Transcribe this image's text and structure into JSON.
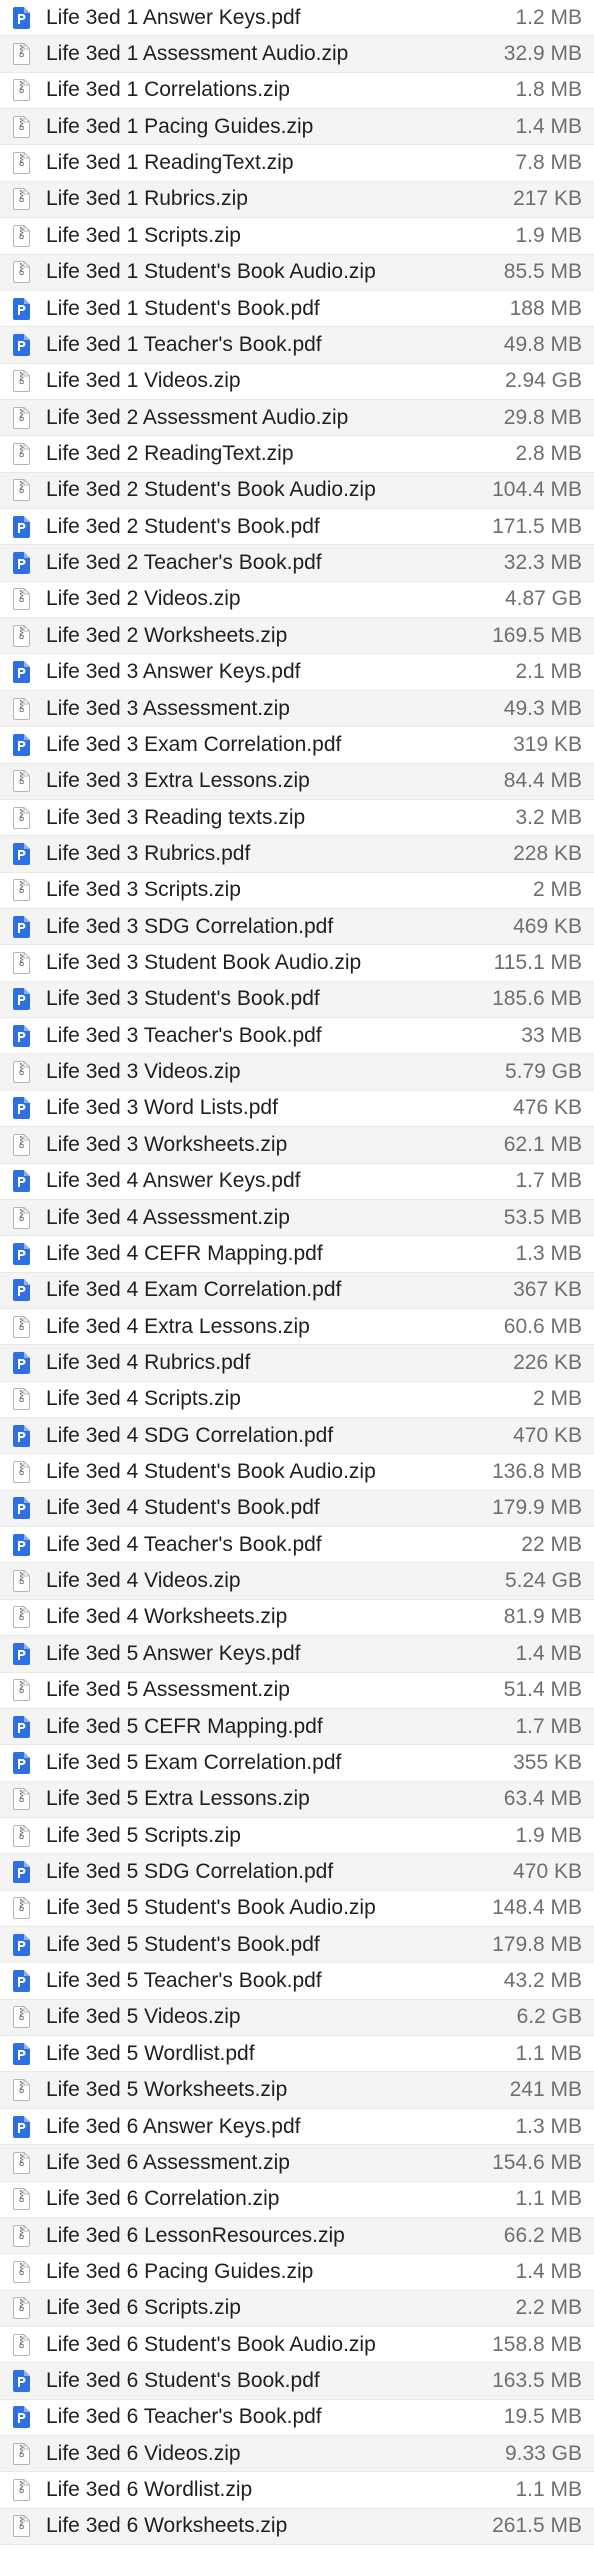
{
  "colors": {
    "pdf_icon": "#2f6fe4",
    "zip_icon_border": "#b5b5b5",
    "size_text": "#6e6e73",
    "stripe": "#f4f4f5"
  },
  "files": [
    {
      "name": "Life 3ed 1 Answer Keys.pdf",
      "size": "1.2 MB",
      "icon": "pdf-icon"
    },
    {
      "name": "Life 3ed 1 Assessment Audio.zip",
      "size": "32.9 MB",
      "icon": "zip-icon"
    },
    {
      "name": "Life 3ed 1 Correlations.zip",
      "size": "1.8 MB",
      "icon": "zip-icon"
    },
    {
      "name": "Life 3ed 1 Pacing Guides.zip",
      "size": "1.4 MB",
      "icon": "zip-icon"
    },
    {
      "name": "Life 3ed 1 ReadingText.zip",
      "size": "7.8 MB",
      "icon": "zip-icon"
    },
    {
      "name": "Life 3ed 1 Rubrics.zip",
      "size": "217 KB",
      "icon": "zip-icon"
    },
    {
      "name": "Life 3ed 1 Scripts.zip",
      "size": "1.9 MB",
      "icon": "zip-icon"
    },
    {
      "name": "Life 3ed 1 Student's Book Audio.zip",
      "size": "85.5 MB",
      "icon": "zip-icon"
    },
    {
      "name": "Life 3ed 1 Student's Book.pdf",
      "size": "188 MB",
      "icon": "pdf-icon"
    },
    {
      "name": "Life 3ed 1 Teacher's Book.pdf",
      "size": "49.8 MB",
      "icon": "pdf-icon"
    },
    {
      "name": "Life 3ed 1 Videos.zip",
      "size": "2.94 GB",
      "icon": "zip-icon"
    },
    {
      "name": "Life 3ed 2 Assessment Audio.zip",
      "size": "29.8 MB",
      "icon": "zip-icon"
    },
    {
      "name": "Life 3ed 2 ReadingText.zip",
      "size": "2.8 MB",
      "icon": "zip-icon"
    },
    {
      "name": "Life 3ed 2 Student's Book Audio.zip",
      "size": "104.4 MB",
      "icon": "zip-icon"
    },
    {
      "name": "Life 3ed 2 Student's Book.pdf",
      "size": "171.5 MB",
      "icon": "pdf-icon"
    },
    {
      "name": "Life 3ed 2 Teacher's Book.pdf",
      "size": "32.3 MB",
      "icon": "pdf-icon"
    },
    {
      "name": "Life 3ed 2 Videos.zip",
      "size": "4.87 GB",
      "icon": "zip-icon"
    },
    {
      "name": "Life 3ed 2 Worksheets.zip",
      "size": "169.5 MB",
      "icon": "zip-icon"
    },
    {
      "name": "Life 3ed 3 Answer Keys.pdf",
      "size": "2.1 MB",
      "icon": "pdf-icon"
    },
    {
      "name": "Life 3ed 3 Assessment.zip",
      "size": "49.3 MB",
      "icon": "zip-icon"
    },
    {
      "name": "Life 3ed 3 Exam Correlation.pdf",
      "size": "319 KB",
      "icon": "pdf-icon"
    },
    {
      "name": "Life 3ed 3 Extra Lessons.zip",
      "size": "84.4 MB",
      "icon": "zip-icon"
    },
    {
      "name": "Life 3ed 3 Reading texts.zip",
      "size": "3.2 MB",
      "icon": "zip-icon"
    },
    {
      "name": "Life 3ed 3 Rubrics.pdf",
      "size": "228 KB",
      "icon": "pdf-icon"
    },
    {
      "name": "Life 3ed 3 Scripts.zip",
      "size": "2 MB",
      "icon": "zip-icon"
    },
    {
      "name": "Life 3ed 3 SDG Correlation.pdf",
      "size": "469 KB",
      "icon": "pdf-icon"
    },
    {
      "name": "Life 3ed 3 Student Book Audio.zip",
      "size": "115.1 MB",
      "icon": "zip-icon"
    },
    {
      "name": "Life 3ed 3 Student's Book.pdf",
      "size": "185.6 MB",
      "icon": "pdf-icon"
    },
    {
      "name": "Life 3ed 3 Teacher's Book.pdf",
      "size": "33 MB",
      "icon": "pdf-icon"
    },
    {
      "name": "Life 3ed 3 Videos.zip",
      "size": "5.79 GB",
      "icon": "zip-icon"
    },
    {
      "name": "Life 3ed 3 Word Lists.pdf",
      "size": "476 KB",
      "icon": "pdf-icon"
    },
    {
      "name": "Life 3ed 3 Worksheets.zip",
      "size": "62.1 MB",
      "icon": "zip-icon"
    },
    {
      "name": "Life 3ed 4 Answer Keys.pdf",
      "size": "1.7 MB",
      "icon": "pdf-icon"
    },
    {
      "name": "Life 3ed 4 Assessment.zip",
      "size": "53.5 MB",
      "icon": "zip-icon"
    },
    {
      "name": "Life 3ed 4 CEFR Mapping.pdf",
      "size": "1.3 MB",
      "icon": "pdf-icon"
    },
    {
      "name": "Life 3ed 4 Exam Correlation.pdf",
      "size": "367 KB",
      "icon": "pdf-icon"
    },
    {
      "name": "Life 3ed 4 Extra Lessons.zip",
      "size": "60.6 MB",
      "icon": "zip-icon"
    },
    {
      "name": "Life 3ed 4 Rubrics.pdf",
      "size": "226 KB",
      "icon": "pdf-icon"
    },
    {
      "name": "Life 3ed 4 Scripts.zip",
      "size": "2 MB",
      "icon": "zip-icon"
    },
    {
      "name": "Life 3ed 4 SDG Correlation.pdf",
      "size": "470 KB",
      "icon": "pdf-icon"
    },
    {
      "name": "Life 3ed 4 Student's Book Audio.zip",
      "size": "136.8 MB",
      "icon": "zip-icon"
    },
    {
      "name": "Life 3ed 4 Student's Book.pdf",
      "size": "179.9 MB",
      "icon": "pdf-icon"
    },
    {
      "name": "Life 3ed 4 Teacher's Book.pdf",
      "size": "22 MB",
      "icon": "pdf-icon"
    },
    {
      "name": "Life 3ed 4 Videos.zip",
      "size": "5.24 GB",
      "icon": "zip-icon"
    },
    {
      "name": "Life 3ed 4 Worksheets.zip",
      "size": "81.9 MB",
      "icon": "zip-icon"
    },
    {
      "name": "Life 3ed 5 Answer Keys.pdf",
      "size": "1.4 MB",
      "icon": "pdf-icon"
    },
    {
      "name": "Life 3ed 5 Assessment.zip",
      "size": "51.4 MB",
      "icon": "zip-icon"
    },
    {
      "name": "Life 3ed 5 CEFR Mapping.pdf",
      "size": "1.7 MB",
      "icon": "pdf-icon"
    },
    {
      "name": "Life 3ed 5 Exam Correlation.pdf",
      "size": "355 KB",
      "icon": "pdf-icon"
    },
    {
      "name": "Life 3ed 5 Extra Lessons.zip",
      "size": "63.4 MB",
      "icon": "zip-icon"
    },
    {
      "name": "Life 3ed 5 Scripts.zip",
      "size": "1.9 MB",
      "icon": "zip-icon"
    },
    {
      "name": "Life 3ed 5 SDG Correlation.pdf",
      "size": "470 KB",
      "icon": "pdf-icon"
    },
    {
      "name": "Life 3ed 5 Student's Book Audio.zip",
      "size": "148.4 MB",
      "icon": "zip-icon"
    },
    {
      "name": "Life 3ed 5 Student's Book.pdf",
      "size": "179.8 MB",
      "icon": "pdf-icon"
    },
    {
      "name": "Life 3ed 5 Teacher's Book.pdf",
      "size": "43.2 MB",
      "icon": "pdf-icon"
    },
    {
      "name": "Life 3ed 5 Videos.zip",
      "size": "6.2 GB",
      "icon": "zip-icon"
    },
    {
      "name": "Life 3ed 5 Wordlist.pdf",
      "size": "1.1 MB",
      "icon": "pdf-icon"
    },
    {
      "name": "Life 3ed 5 Worksheets.zip",
      "size": "241 MB",
      "icon": "zip-icon"
    },
    {
      "name": "Life 3ed 6 Answer Keys.pdf",
      "size": "1.3 MB",
      "icon": "pdf-icon"
    },
    {
      "name": "Life 3ed 6 Assessment.zip",
      "size": "154.6 MB",
      "icon": "zip-icon"
    },
    {
      "name": "Life 3ed 6 Correlation.zip",
      "size": "1.1 MB",
      "icon": "zip-icon"
    },
    {
      "name": "Life 3ed 6 LessonResources.zip",
      "size": "66.2 MB",
      "icon": "zip-icon"
    },
    {
      "name": "Life 3ed 6 Pacing Guides.zip",
      "size": "1.4 MB",
      "icon": "zip-icon"
    },
    {
      "name": "Life 3ed 6 Scripts.zip",
      "size": "2.2 MB",
      "icon": "zip-icon"
    },
    {
      "name": "Life 3ed 6 Student's Book Audio.zip",
      "size": "158.8 MB",
      "icon": "zip-icon"
    },
    {
      "name": "Life 3ed 6 Student's Book.pdf",
      "size": "163.5 MB",
      "icon": "pdf-icon"
    },
    {
      "name": "Life 3ed 6 Teacher's Book.pdf",
      "size": "19.5 MB",
      "icon": "pdf-icon"
    },
    {
      "name": "Life 3ed 6 Videos.zip",
      "size": "9.33 GB",
      "icon": "zip-icon"
    },
    {
      "name": "Life 3ed 6 Wordlist.zip",
      "size": "1.1 MB",
      "icon": "zip-icon"
    },
    {
      "name": "Life 3ed 6 Worksheets.zip",
      "size": "261.5 MB",
      "icon": "zip-icon"
    }
  ]
}
